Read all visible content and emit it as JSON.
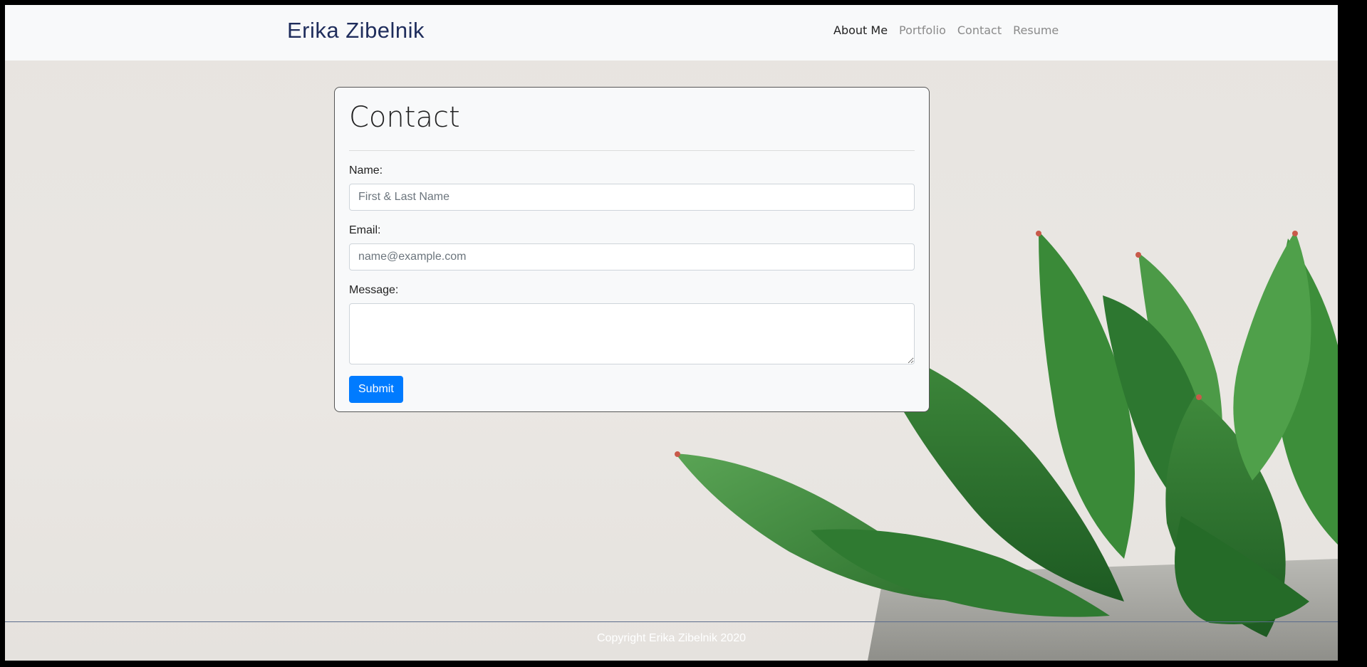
{
  "header": {
    "brand": "Erika Zibelnik",
    "nav": [
      {
        "label": "About Me",
        "active": true
      },
      {
        "label": "Portfolio",
        "active": false
      },
      {
        "label": "Contact",
        "active": false
      },
      {
        "label": "Resume",
        "active": false
      }
    ]
  },
  "contact_form": {
    "title": "Contact",
    "name_label": "Name:",
    "name_placeholder": "First & Last Name",
    "email_label": "Email:",
    "email_placeholder": "name@example.com",
    "message_label": "Message:",
    "message_value": "",
    "submit_label": "Submit"
  },
  "footer": {
    "copyright": "Copyright Erika Zibelnik 2020"
  },
  "colors": {
    "brand": "#1f2d5c",
    "button": "#007bff",
    "navbar_bg": "#f8f9fa"
  }
}
